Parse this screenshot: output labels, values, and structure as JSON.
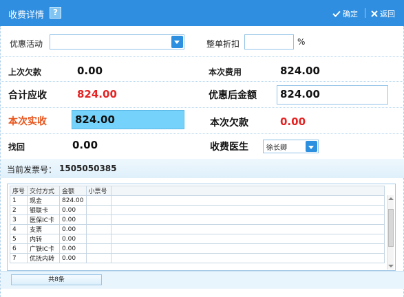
{
  "window": {
    "title": "收费详情",
    "help_label": "?",
    "confirm_label": "确定",
    "back_label": "返回"
  },
  "discount": {
    "activity_label": "优惠活动",
    "activity_value": "",
    "order_discount_label": "整单折扣",
    "order_discount_value": "",
    "percent_sign": "%"
  },
  "amounts": {
    "last_arrears_label": "上次欠款",
    "last_arrears_value": "0.00",
    "current_fee_label": "本次费用",
    "current_fee_value": "824.00",
    "total_receivable_label": "合计应收",
    "total_receivable_value": "824.00",
    "after_discount_label": "优惠后金额",
    "after_discount_value": "824.00",
    "actual_received_label": "本次实收",
    "actual_received_value": "824.00",
    "current_arrears_label": "本次欠款",
    "current_arrears_value": "0.00",
    "change_label": "找回",
    "change_value": "0.00",
    "doctor_label": "收费医生",
    "doctor_value": "徐长卿"
  },
  "invoice": {
    "label": "当前发票号：",
    "number": "1505050385"
  },
  "payments": {
    "columns": [
      "序号",
      "交付方式",
      "金额",
      "小票号"
    ],
    "rows": [
      {
        "no": "1",
        "method": "现金",
        "amount": "824.00",
        "receipt": ""
      },
      {
        "no": "2",
        "method": "银联卡",
        "amount": "0.00",
        "receipt": ""
      },
      {
        "no": "3",
        "method": "医保IC卡",
        "amount": "0.00",
        "receipt": ""
      },
      {
        "no": "4",
        "method": "支票",
        "amount": "0.00",
        "receipt": ""
      },
      {
        "no": "5",
        "method": "内转",
        "amount": "0.00",
        "receipt": ""
      },
      {
        "no": "6",
        "method": "广铁IC卡",
        "amount": "0.00",
        "receipt": ""
      },
      {
        "no": "7",
        "method": "优抚内转",
        "amount": "0.00",
        "receipt": ""
      }
    ],
    "total_label": "共8条"
  },
  "colors": {
    "title_bar": "#2f8ee0",
    "highlight_red": "#e52323",
    "highlight_orange": "#e8541b",
    "selected_input": "#75d3fb"
  }
}
